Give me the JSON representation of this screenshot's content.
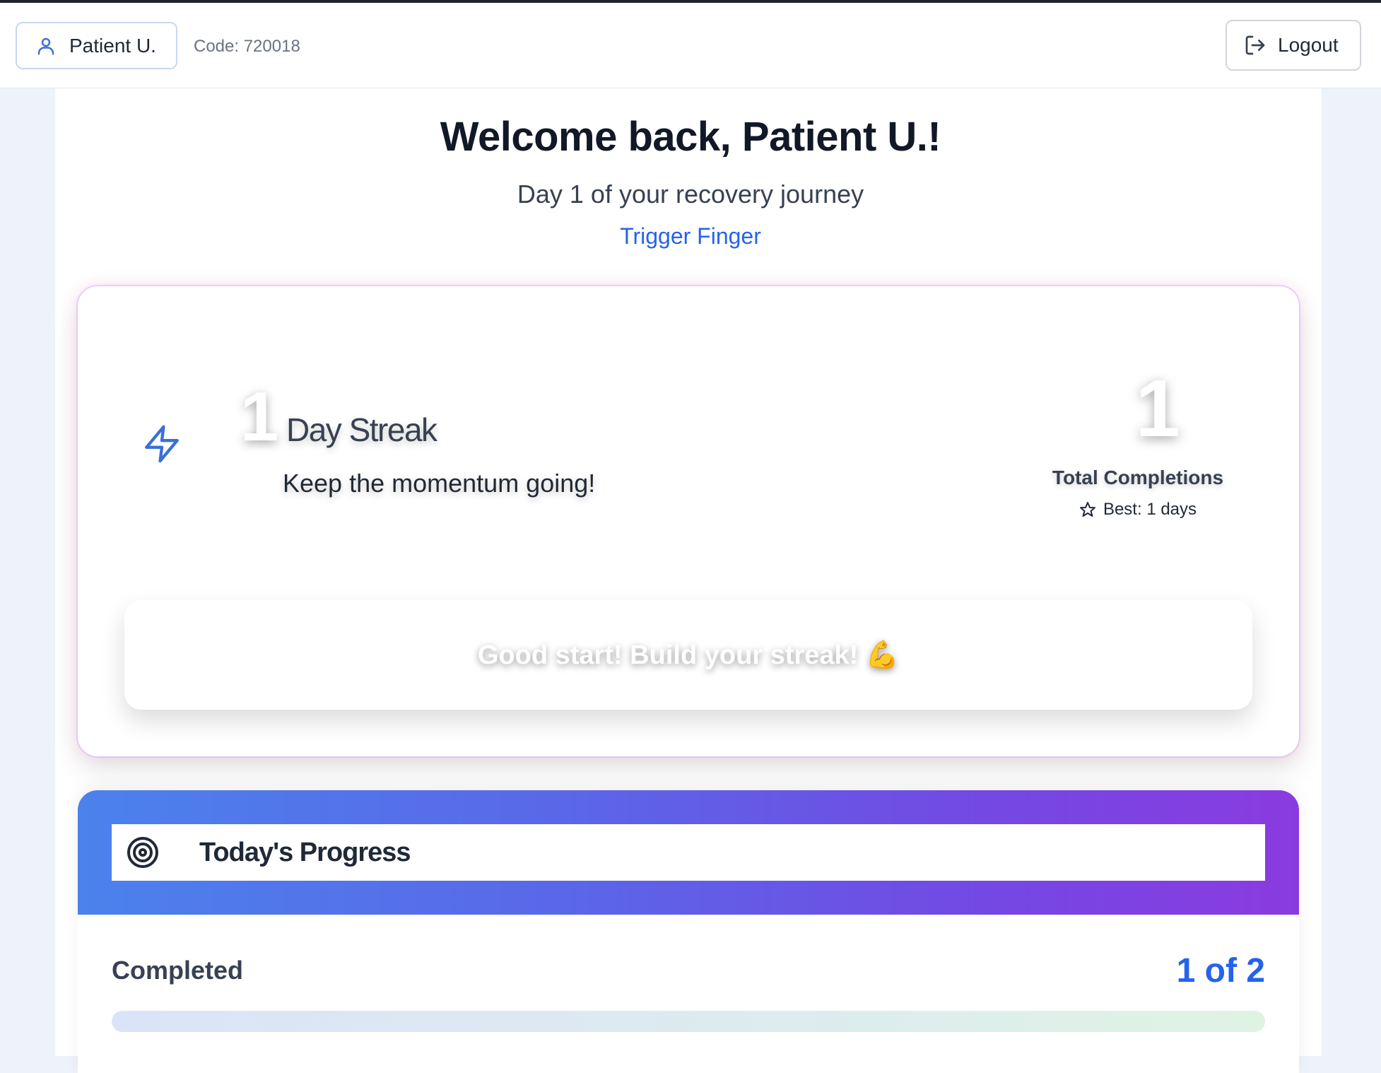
{
  "header": {
    "patient_name": "Patient U.",
    "code_text": "Code: 720018",
    "logout_label": "Logout"
  },
  "welcome": {
    "title": "Welcome back, Patient U.!",
    "subtitle": "Day 1 of your recovery journey",
    "condition": "Trigger Finger"
  },
  "streak": {
    "days": "1",
    "label": "Day Streak",
    "message": "Keep the momentum going!",
    "total_completions": "1",
    "total_label": "Total Completions",
    "best_text": "Best: 1 days",
    "encouragement": "Good start! Build your streak! 💪"
  },
  "progress": {
    "title": "Today's Progress",
    "completed_label": "Completed",
    "completed_count": "1 of 2",
    "fraction": 0.5
  },
  "colors": {
    "accent": "#2563eb",
    "gradient_start": "#4b82ec",
    "gradient_end": "#8a3be0"
  },
  "icons": {
    "patient": "user-icon",
    "logout": "logout-icon",
    "streak": "lightning-icon",
    "best": "star-icon",
    "progress": "target-icon"
  }
}
